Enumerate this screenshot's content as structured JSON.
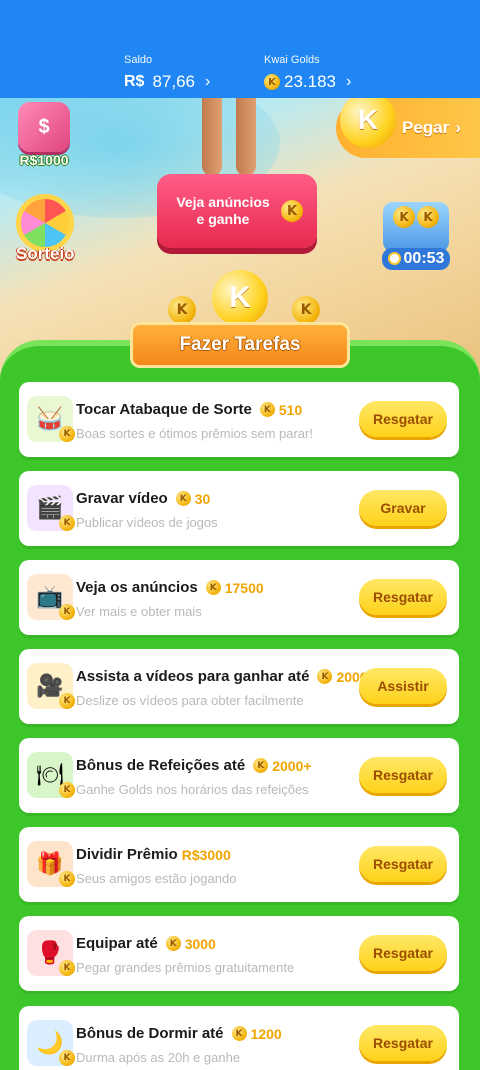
{
  "header": {
    "saldo_label": "Saldo",
    "saldo_currency": "R$",
    "saldo_value": "87,66",
    "golds_label": "Kwai Golds",
    "golds_value": "23.183",
    "chevron": "›"
  },
  "scene": {
    "money_label": "R$1000",
    "sorteio_label": "Sorteio",
    "ad_button_text": "Veja anúncios e ganhe",
    "pegar_label": "Pegar",
    "timer": "00:53",
    "coin_letter": "K"
  },
  "banner": {
    "title": "Fazer Tarefas"
  },
  "tasks": [
    {
      "title": "Tocar Atabaque de Sorte",
      "reward": "510",
      "subtitle": "Boas sortes e ótimos prêmios sem parar!",
      "action": "Resgatar",
      "icon": "drum-icon",
      "icon_bg": "#e9f7d2",
      "glyph": "🥁"
    },
    {
      "title": "Gravar vídeo",
      "reward": "30",
      "subtitle": "Publicar vídeos de jogos",
      "action": "Gravar",
      "icon": "video-camera-icon",
      "icon_bg": "#f3e3ff",
      "glyph": "🎬"
    },
    {
      "title": "Veja os anúncios",
      "reward": "17500",
      "subtitle": "Ver mais e obter mais",
      "action": "Resgatar",
      "icon": "tv-icon",
      "icon_bg": "#ffe8d2",
      "glyph": "📺"
    },
    {
      "title": "Assista a vídeos para ganhar até",
      "reward": "2000",
      "subtitle": "Deslize os vídeos para obter facilmente",
      "action": "Assistir",
      "icon": "movie-camera-icon",
      "icon_bg": "#fff1c7",
      "glyph": "🎥"
    },
    {
      "title": "Bônus de Refeições até",
      "reward": "2000+",
      "subtitle": "Ganhe Golds nos horários das refeições",
      "action": "Resgatar",
      "icon": "meal-calendar-icon",
      "icon_bg": "#d8f5c9",
      "glyph": "🍽"
    },
    {
      "title": "Dividir Prêmio",
      "reward": "R$3000",
      "reward_is_cash": true,
      "subtitle": "Seus amigos estão jogando",
      "action": "Resgatar",
      "icon": "gift-box-icon",
      "icon_bg": "#ffe4cc",
      "glyph": "🎁"
    },
    {
      "title": "Equipar até",
      "reward": "3000",
      "subtitle": "Pegar grandes prêmios gratuitamente",
      "action": "Resgatar",
      "icon": "boxing-gloves-icon",
      "icon_bg": "#ffe0e0",
      "glyph": "🥊"
    },
    {
      "title": "Bônus de Dormir até",
      "reward": "1200",
      "subtitle": "Durma após as 20h e ganhe",
      "action": "Resgatar",
      "icon": "moon-icon",
      "icon_bg": "#dbeeff",
      "glyph": "🌙"
    }
  ]
}
